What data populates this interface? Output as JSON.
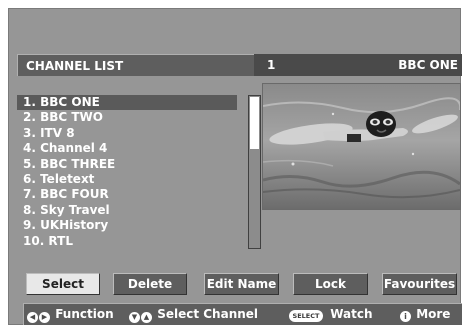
{
  "header": {
    "title": "CHANNEL LIST",
    "channel_number": "1",
    "channel_name": "BBC ONE"
  },
  "channels": [
    {
      "label": "1. BBC ONE",
      "selected": true
    },
    {
      "label": "2. BBC TWO",
      "selected": false
    },
    {
      "label": "3. ITV 8",
      "selected": false
    },
    {
      "label": "4. Channel 4",
      "selected": false
    },
    {
      "label": "5. BBC THREE",
      "selected": false
    },
    {
      "label": "6. Teletext",
      "selected": false
    },
    {
      "label": "7. BBC FOUR",
      "selected": false
    },
    {
      "label": "8. Sky Travel",
      "selected": false
    },
    {
      "label": "9. UKHistory",
      "selected": false
    },
    {
      "label": "10. RTL",
      "selected": false
    }
  ],
  "buttons": {
    "select": "Select",
    "delete": "Delete",
    "edit_name": "Edit Name",
    "lock": "Lock",
    "favourites": "Favourites"
  },
  "help": {
    "function": "Function",
    "select_channel": "Select Channel",
    "select_key": "SELECT",
    "watch": "Watch",
    "more": "More"
  },
  "colors": {
    "background": "#969696",
    "header": "#4a4a4a",
    "button": "#5e5e5e",
    "button_active": "#e8e8e8",
    "text": "#ffffff"
  },
  "icons": {
    "function": "left-right-arrows-icon",
    "select_channel": "up-down-arrows-icon",
    "watch": "select-key-icon",
    "more": "info-icon"
  }
}
